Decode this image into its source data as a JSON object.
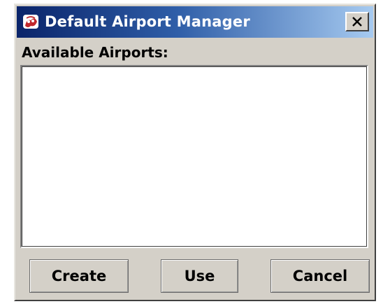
{
  "window": {
    "title": "Default Airport Manager",
    "app_icon": "java-applet-icon",
    "close_icon": "close-x-icon"
  },
  "main": {
    "list_label": "Available Airports:",
    "airports": []
  },
  "buttons": {
    "create_label": "Create",
    "use_label": "Use",
    "cancel_label": "Cancel"
  },
  "colors": {
    "titlebar_start": "#0a246a",
    "titlebar_end": "#a6caf0",
    "window_bg": "#d4d0c8",
    "list_bg": "#ffffff"
  }
}
